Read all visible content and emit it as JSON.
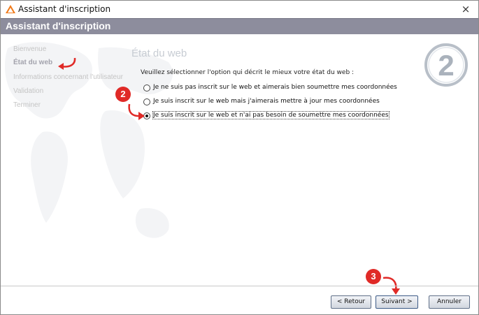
{
  "window": {
    "title": "Assistant d'inscription",
    "close_icon": "×"
  },
  "header": {
    "title": "Assistant d'inscription"
  },
  "sidebar": {
    "items": [
      {
        "label": "Bienvenue",
        "active": false
      },
      {
        "label": "État du web",
        "active": true
      },
      {
        "label": "Informations concernant l'utilisateur",
        "active": false
      },
      {
        "label": "Validation",
        "active": false
      },
      {
        "label": "Terminer",
        "active": false
      }
    ]
  },
  "page": {
    "title": "État du web",
    "step_number": "2",
    "prompt": "Veuillez sélectionner l'option qui décrit le mieux votre état du web :",
    "options": [
      {
        "label": "Je ne suis pas inscrit sur le web et aimerais bien soumettre mes coordonnées",
        "checked": false
      },
      {
        "label": "Je suis inscrit sur le web mais j'aimerais mettre à jour mes coordonnées",
        "checked": false
      },
      {
        "label": "Je suis inscrit sur le web et n'ai pas besoin de soumettre mes coordonnées",
        "checked": true
      }
    ]
  },
  "buttons": {
    "back": "< Retour",
    "next": "Suivant >",
    "cancel": "Annuler"
  },
  "annotations": [
    {
      "number": "2",
      "color": "#e02a27"
    },
    {
      "number": "3",
      "color": "#e02a27"
    }
  ]
}
